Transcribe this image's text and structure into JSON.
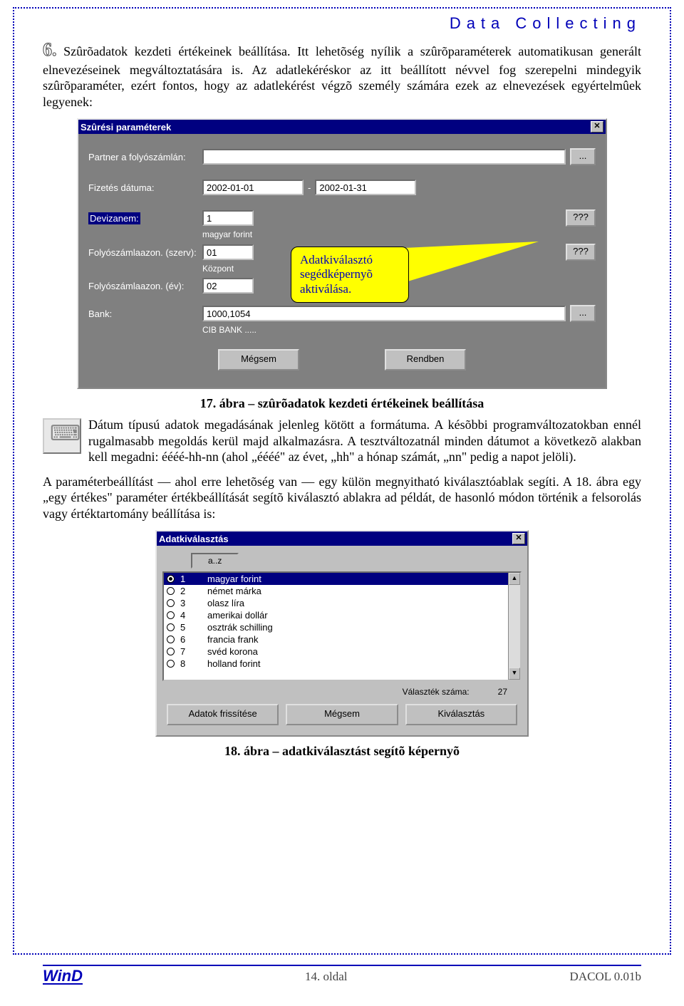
{
  "header": "Data Collecting",
  "section_number": "6.",
  "para1": "Szûrõadatok kezdeti értékeinek beállítása. Itt lehetõség nyílik a szûrõparaméterek automatikusan generált elnevezéseinek megváltoztatására is. Az adatlekéréskor az itt beállított névvel fog szerepelni mindegyik szûrõparaméter, ezért fontos, hogy az adatlekérést végzõ személy számára ezek az elnevezések egyértelmûek legyenek:",
  "dialog1": {
    "title": "Szûrési paraméterek",
    "labels": {
      "partner": "Partner a folyószámlán:",
      "fizetes": "Fizetés dátuma:",
      "devizanem": "Devizanem:",
      "fsz_szerv": "Folyószámlaazon. (szerv):",
      "fsz_ev": "Folyószámlaazon. (év):",
      "bank": "Bank:"
    },
    "values": {
      "fizetes_from": "2002-01-01",
      "fizetes_to": "2002-01-31",
      "devizanem": "1",
      "devizanem_sub": "magyar forint",
      "fsz_szerv": "01",
      "fsz_szerv_sub": "Központ",
      "fsz_ev": "02",
      "bank": "1000,1054",
      "bank_sub": "CIB BANK ....."
    },
    "btn_more": "...",
    "btn_qqq": "???",
    "btn_cancel": "Mégsem",
    "btn_ok": "Rendben",
    "callout": "Adatkiválasztó segédképernyõ aktiválása."
  },
  "caption1": "17. ábra – szûrõadatok kezdeti értékeinek beállítása",
  "para2": "Dátum típusú adatok megadásának jelenleg kötött a formátuma. A késõbbi programváltozatokban ennél rugalmasabb megoldás kerül majd alkalmazásra. A tesztváltozatnál minden dátumot a következõ alakban kell megadni: éééé-hh-nn (ahol „éééé\" az évet, „hh\" a hónap számát, „nn\" pedig a napot jelöli).",
  "para3": "A paraméterbeállítást — ahol erre lehetõség van — egy külön megnyitható kiválasztóablak segíti. A 18. ábra egy „egy értékes\" paraméter értékbeállítását segítõ kiválasztó ablakra ad példát, de hasonló módon történik a felsorolás vagy értéktartomány beállítása is:",
  "dialog2": {
    "title": "Adatkiválasztás",
    "az": "a..z",
    "items": [
      {
        "n": "1",
        "label": "magyar forint",
        "selected": true
      },
      {
        "n": "2",
        "label": "német márka"
      },
      {
        "n": "3",
        "label": "olasz líra"
      },
      {
        "n": "4",
        "label": "amerikai dollár"
      },
      {
        "n": "5",
        "label": "osztrák schilling"
      },
      {
        "n": "6",
        "label": "francia frank"
      },
      {
        "n": "7",
        "label": "svéd korona"
      },
      {
        "n": "8",
        "label": "holland forint"
      }
    ],
    "count_label": "Választék száma:",
    "count_value": "27",
    "btn_refresh": "Adatok frissítése",
    "btn_cancel": "Mégsem",
    "btn_select": "Kiválasztás"
  },
  "caption2": "18. ábra – adatkiválasztást segítõ képernyõ",
  "footer": {
    "logo": "WinD",
    "center": "14. oldal",
    "right": "DACOL 0.01b"
  }
}
